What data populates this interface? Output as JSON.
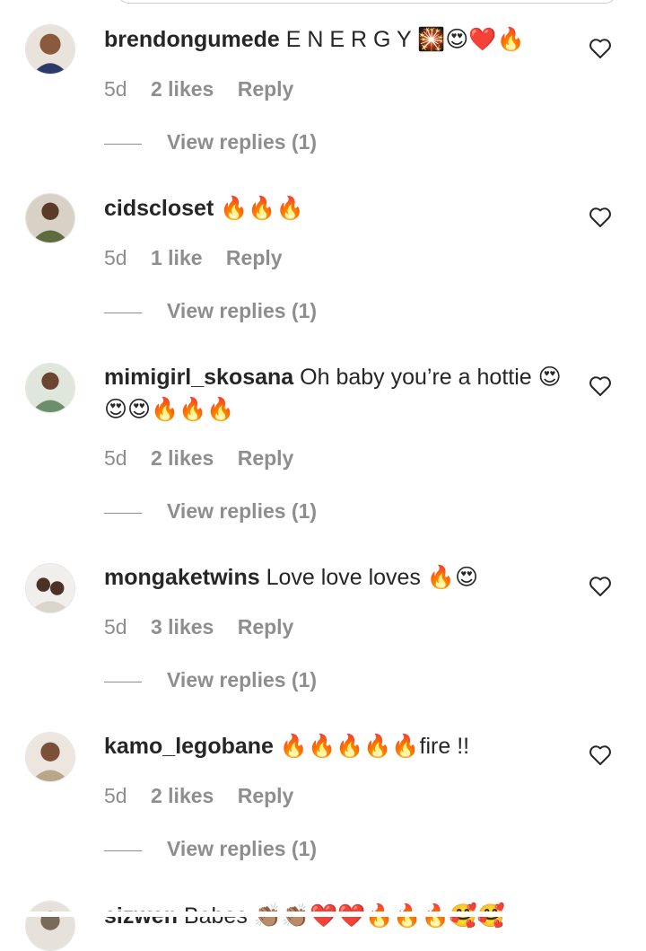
{
  "comments": [
    {
      "username": "brendongumede",
      "text": "E N E R G Y 🎇😍❤️🔥",
      "time": "5d",
      "likes": "2 likes",
      "reply": "Reply",
      "view_replies": "View replies (1)",
      "avatar_color": "#c58a5e"
    },
    {
      "username": "cidscloset",
      "text": "🔥🔥🔥",
      "time": "5d",
      "likes": "1 like",
      "reply": "Reply",
      "view_replies": "View replies (1)",
      "avatar_color": "#5d6b3f"
    },
    {
      "username": "mimigirl_skosana",
      "text": "Oh baby you’re a hottie 😍😍😍🔥🔥🔥",
      "time": "5d",
      "likes": "2 likes",
      "reply": "Reply",
      "view_replies": "View replies (1)",
      "avatar_color": "#6a8f6a"
    },
    {
      "username": "mongaketwins",
      "text": "Love love loves 🔥😍",
      "time": "5d",
      "likes": "3 likes",
      "reply": "Reply",
      "view_replies": "View replies (1)",
      "avatar_color": "#d9d4cc"
    },
    {
      "username": "kamo_legobane",
      "text": "🔥🔥🔥🔥🔥fire !!",
      "time": "5d",
      "likes": "2 likes",
      "reply": "Reply",
      "view_replies": "View replies (1)",
      "avatar_color": "#b8a58a"
    },
    {
      "username": "sizwen",
      "text": "Babes 👏🏽👏🏽❤️❤️🔥🔥🔥🥰🥰",
      "avatar_color": "#7a6a5a"
    }
  ],
  "icons": {
    "like": "heart-outline-icon"
  },
  "colors": {
    "username": "#262626",
    "meta": "#8e8e8e",
    "background": "#ffffff"
  }
}
